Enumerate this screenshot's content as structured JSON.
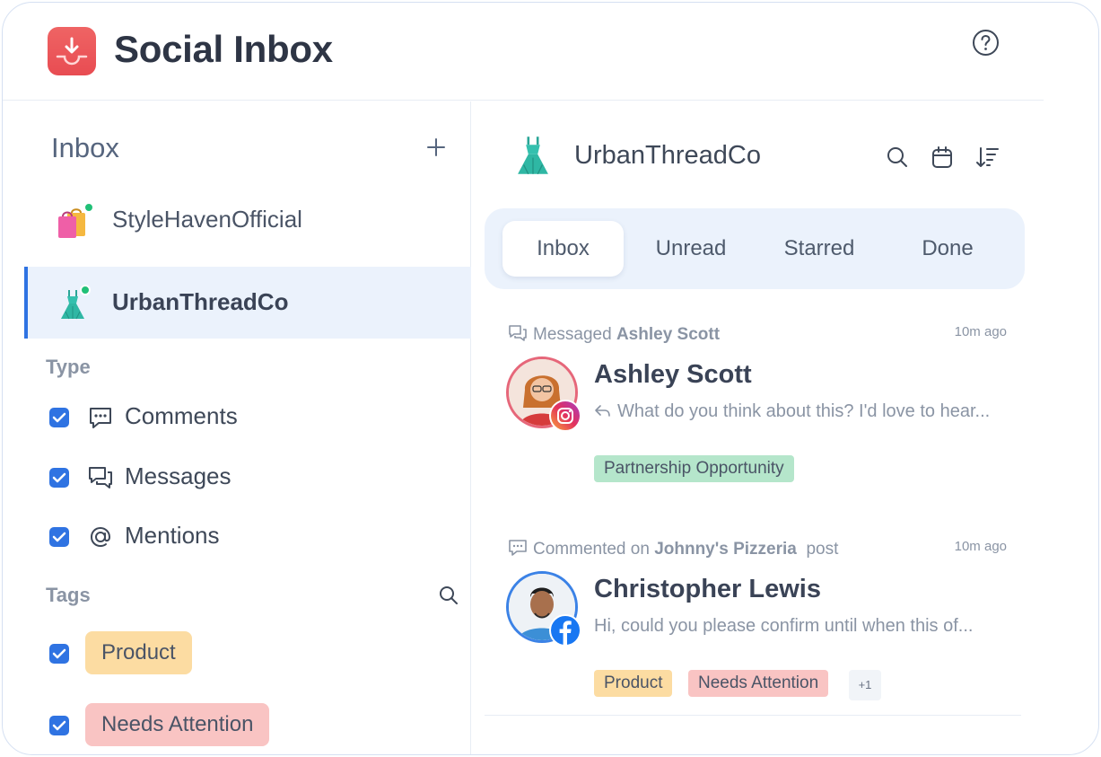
{
  "app": {
    "title": "Social Inbox",
    "logo_icon": "inbox-download-icon",
    "help_icon": "help-icon"
  },
  "sidebar": {
    "title": "Inbox",
    "add_icon": "plus-icon",
    "accounts": [
      {
        "name": "StyleHavenOfficial",
        "avatar": "shopping-bags-icon",
        "online": true,
        "active": false
      },
      {
        "name": "UrbanThreadCo",
        "avatar": "dress-icon",
        "online": true,
        "active": true
      }
    ],
    "type_label": "Type",
    "types": [
      {
        "label": "Comments",
        "icon": "comment-icon",
        "checked": true
      },
      {
        "label": "Messages",
        "icon": "messages-icon",
        "checked": true
      },
      {
        "label": "Mentions",
        "icon": "at-icon",
        "checked": true
      }
    ],
    "tags_label": "Tags",
    "tags": [
      {
        "label": "Product",
        "color": "#fcdca2",
        "checked": true
      },
      {
        "label": "Needs Attention",
        "color": "#f9c4c3",
        "checked": true
      }
    ]
  },
  "main": {
    "account_name": "UrbanThreadCo",
    "account_avatar": "dress-icon",
    "toolbar_icons": [
      "search-icon",
      "calendar-icon",
      "sort-icon"
    ],
    "tabs": [
      {
        "label": "Inbox",
        "active": true
      },
      {
        "label": "Unread",
        "active": false
      },
      {
        "label": "Starred",
        "active": false
      },
      {
        "label": "Done",
        "active": false
      }
    ],
    "messages": [
      {
        "meta_prefix": "Messaged",
        "meta_bold": "Ashley Scott",
        "meta_suffix": "",
        "time": "10m ago",
        "name": "Ashley Scott",
        "preview": "What do you think about this? I'd love to hear...",
        "network": "instagram",
        "tags": [
          {
            "label": "Partnership Opportunity",
            "color": "#b5e6cb"
          }
        ]
      },
      {
        "meta_prefix": "Commented on",
        "meta_bold": "Johnny's Pizzeria",
        "meta_suffix": "post",
        "time": "10m ago",
        "name": "Christopher Lewis",
        "preview": "Hi, could you please confirm until when this of...",
        "network": "facebook",
        "tags": [
          {
            "label": "Product",
            "color": "#fcdca2"
          },
          {
            "label": "Needs Attention",
            "color": "#f9c4c3"
          }
        ],
        "more_tags": "+1"
      }
    ]
  },
  "colors": {
    "accent": "#2f73e2",
    "online": "#21c077",
    "active_bg": "#ebf2fc"
  }
}
